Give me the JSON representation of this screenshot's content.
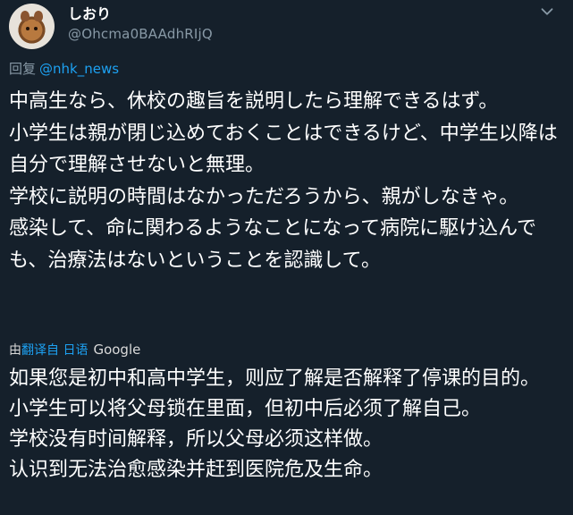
{
  "tweet": {
    "author": {
      "display_name": "しおり",
      "handle": "@Ohcma0BAAdhRIjQ"
    },
    "reply_label": "回复",
    "reply_to": "@nhk_news",
    "text": "中高生なら、休校の趣旨を説明したら理解できるはず。\n小学生は親が閉じ込めておくことはできるけど、中学生以降は自分で理解させないと無理。\n学校に説明の時間はなかっただろうから、親がしなきゃ。\n感染して、命に関わるようなことになって病院に駆け込んでも、治療法はないということを認識して。",
    "translation": {
      "by_label": "由",
      "link_label": "翻译自 日语",
      "provider": "Google",
      "text": "如果您是初中和高中学生，则应了解是否解释了停课的目的。\n小学生可以将父母锁在里面，但初中后必须了解自己。\n学校没有时间解释，所以父母必须这样做。\n认识到无法治愈感染并赶到医院危及生命。"
    }
  },
  "icons": {
    "more": "chevron-down-icon",
    "avatar": "cat-avatar"
  },
  "colors": {
    "background": "#15202b",
    "text": "#ffffff",
    "secondary": "#8899a6",
    "link": "#1da1f2"
  }
}
